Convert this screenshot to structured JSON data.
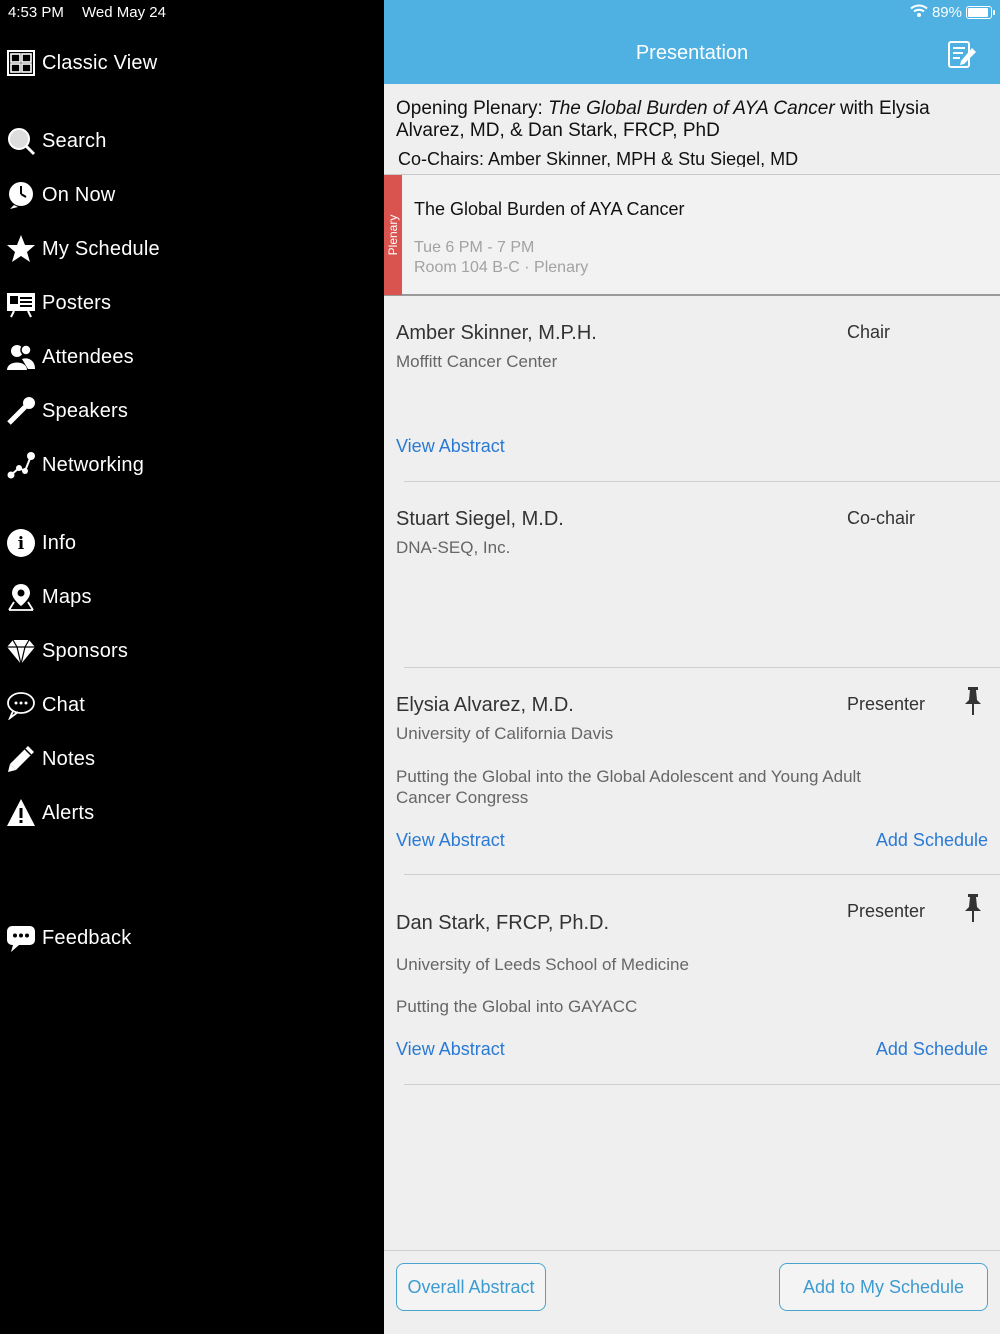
{
  "status": {
    "time": "4:53 PM",
    "date": "Wed May 24",
    "battery": "89%",
    "battery_level": 0.89
  },
  "sidebar": {
    "items": [
      {
        "label": "Classic View",
        "icon": "grid-icon"
      },
      {
        "label": "Search",
        "icon": "search-icon"
      },
      {
        "label": "On Now",
        "icon": "clock-icon"
      },
      {
        "label": "My Schedule",
        "icon": "star-icon"
      },
      {
        "label": "Posters",
        "icon": "poster-board-icon"
      },
      {
        "label": "Attendees",
        "icon": "people-icon"
      },
      {
        "label": "Speakers",
        "icon": "microphone-icon"
      },
      {
        "label": "Networking",
        "icon": "network-icon"
      },
      {
        "label": "Info",
        "icon": "info-icon"
      },
      {
        "label": "Maps",
        "icon": "map-pin-icon"
      },
      {
        "label": "Sponsors",
        "icon": "diamond-icon"
      },
      {
        "label": "Chat",
        "icon": "chat-bubble-icon"
      },
      {
        "label": "Notes",
        "icon": "pencil-icon"
      },
      {
        "label": "Alerts",
        "icon": "warning-icon"
      },
      {
        "label": "Feedback",
        "icon": "feedback-bubble-icon"
      }
    ]
  },
  "header": {
    "title": "Presentation",
    "notes_icon": "notes-edit-icon"
  },
  "presentation": {
    "heading_prefix": "Opening Plenary: ",
    "heading_italic": "The Global Burden of AYA Cancer",
    "heading_suffix": " with Elysia Alvarez, MD, & Dan Stark, FRCP, PhD",
    "cochairs": "Co-Chairs: Amber Skinner, MPH & Stu Siegel, MD"
  },
  "session": {
    "tag": "Plenary",
    "tag_color": "#d9534f",
    "title": "The Global Burden of AYA Cancer",
    "time": "Tue 6 PM - 7 PM",
    "room": "Room 104 B-C · Plenary"
  },
  "people": [
    {
      "name": "Amber Skinner, M.P.H.",
      "role": "Chair",
      "affiliation": "Moffitt Cancer Center",
      "talk": "",
      "view_abstract": "View Abstract",
      "add_schedule": ""
    },
    {
      "name": "Stuart Siegel, M.D.",
      "role": "Co-chair",
      "affiliation": "DNA-SEQ, Inc.",
      "talk": "",
      "view_abstract": "",
      "add_schedule": ""
    },
    {
      "name": "Elysia Alvarez, M.D.",
      "role": "Presenter",
      "affiliation": "University of California Davis",
      "talk": "Putting the Global into the Global Adolescent and Young Adult Cancer Congress",
      "view_abstract": "View Abstract",
      "add_schedule": "Add Schedule"
    },
    {
      "name": "Dan Stark, FRCP, Ph.D.",
      "role": "Presenter",
      "affiliation": "University of Leeds School of Medicine",
      "talk": "Putting the Global into GAYACC",
      "view_abstract": "View Abstract",
      "add_schedule": "Add Schedule"
    }
  ],
  "footer": {
    "overall_abstract": "Overall Abstract",
    "add_to_schedule": "Add to My Schedule"
  },
  "colors": {
    "accent": "#4eb1e2",
    "link": "#2a7ad4"
  }
}
